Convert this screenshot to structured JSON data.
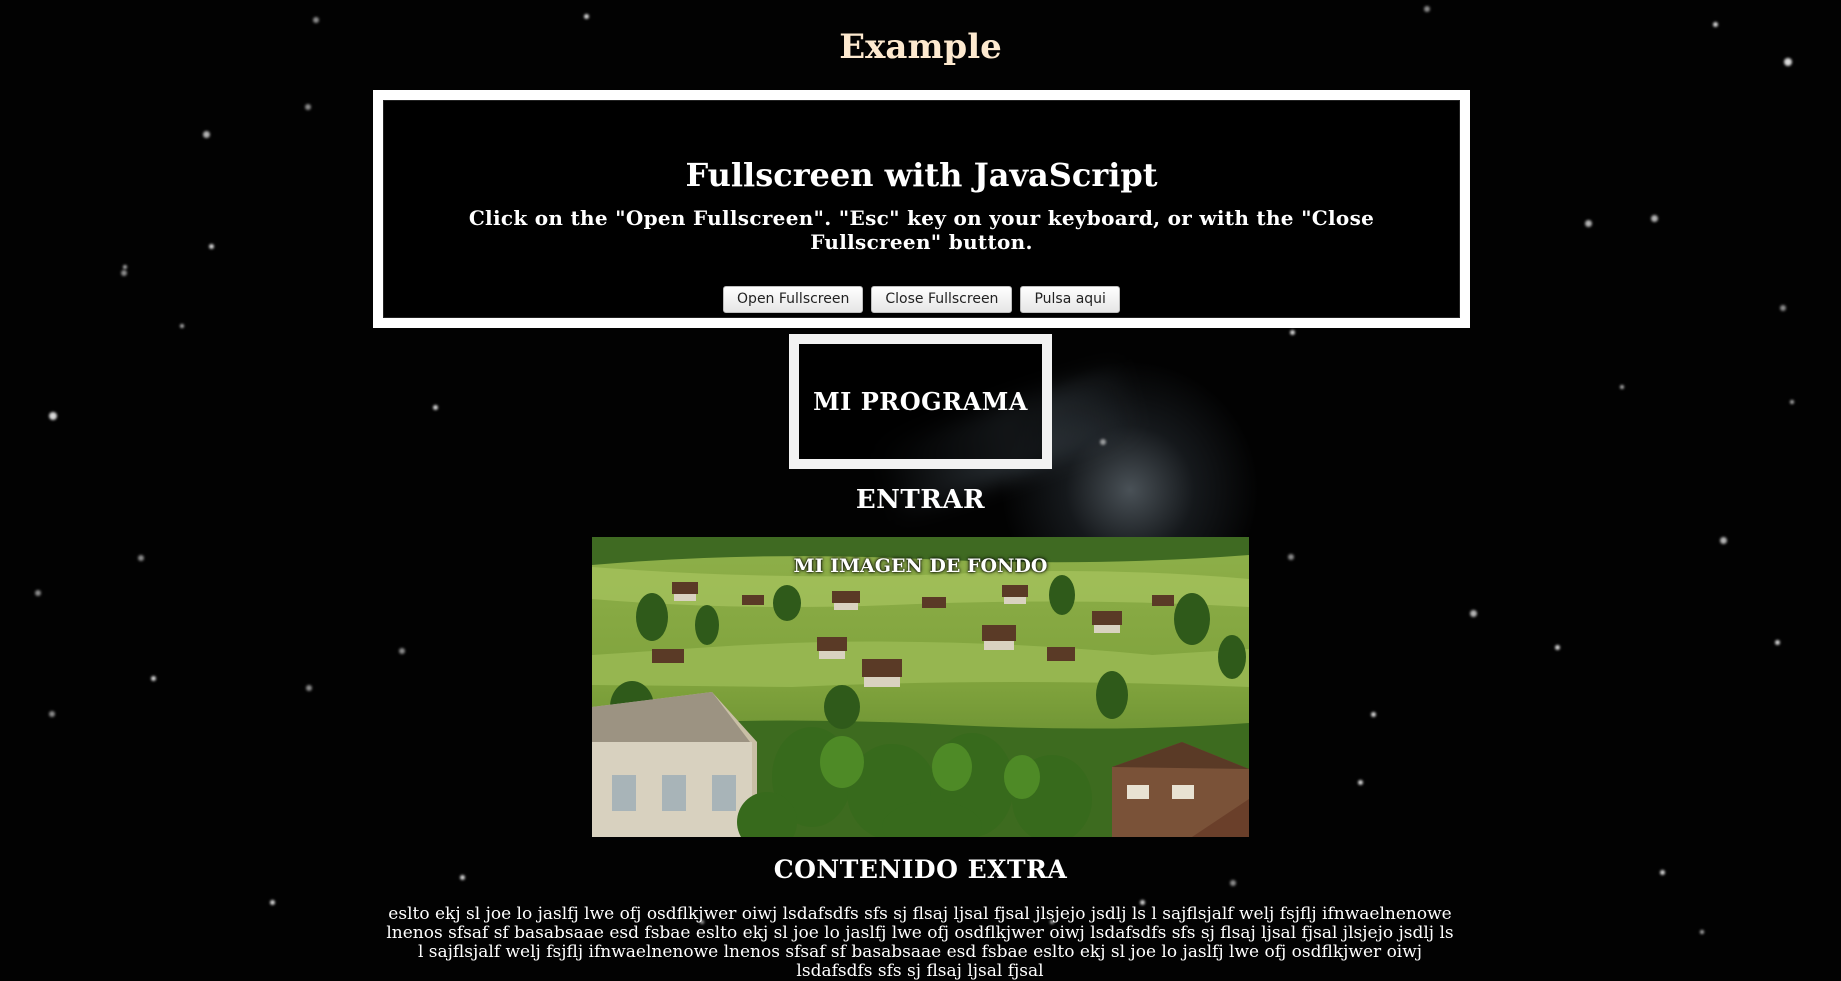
{
  "page": {
    "title": "Example"
  },
  "fullscreen_panel": {
    "heading": "Fullscreen with JavaScript",
    "instructions": "Click on the \"Open Fullscreen\". \"Esc\" key on your keyboard, or with the \"Close Fullscreen\" button.",
    "buttons": {
      "open": "Open Fullscreen",
      "close": "Close Fullscreen",
      "extra": "Pulsa aqui"
    }
  },
  "program_box": {
    "label": "MI PROGRAMA"
  },
  "enter_link": "ENTRAR",
  "image_panel": {
    "caption": "MI IMAGEN DE FONDO"
  },
  "extra_section": {
    "title": "CONTENIDO EXTRA",
    "body": "eslto ekj sl joe lo jaslfj lwe ofj osdflkjwer oiwj lsdafsdfs sfs sj flsaj ljsal fjsal jlsjejo jsdlj ls l sajflsjalf welj fsjflj ifnwaelnenowe lnenos sfsaf sf basabsaae esd fsbae eslto ekj sl joe lo jaslfj lwe ofj osdflkjwer oiwj lsdafsdfs sfs sj flsaj ljsal fjsal jlsjejo jsdlj ls l sajflsjalf welj fsjflj ifnwaelnenowe lnenos sfsaf sf basabsaae esd fsbae eslto ekj sl joe lo jaslfj lwe ofj osdflkjwer oiwj lsdafsdfs sfs sj flsaj ljsal fjsal"
  },
  "colors": {
    "background": "#020202",
    "title": "#fde9cf",
    "panel_border": "#ffffff"
  }
}
